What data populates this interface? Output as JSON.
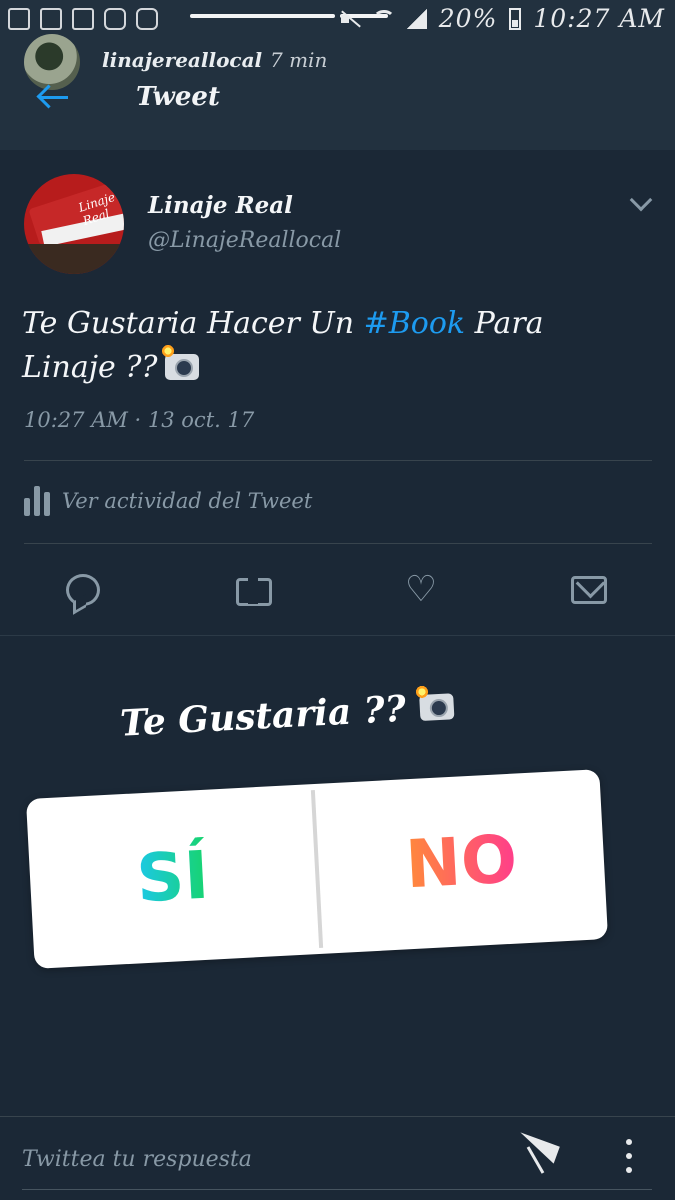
{
  "status_bar": {
    "battery_text": "20%",
    "clock": "10:27 AM"
  },
  "story_header": {
    "username": "linajereallocal",
    "time_ago": "7 min",
    "title": "Tweet"
  },
  "tweet": {
    "author_name": "Linaje Real",
    "author_handle": "@LinajeReallocal",
    "text_before": "Te Gustaria Hacer Un ",
    "hashtag": "#Book",
    "text_after": " Para Linaje ??",
    "timestamp": "10:27 AM · 13 oct. 17",
    "activity_label": "Ver actividad del Tweet",
    "avatar_logo_text": "Linaje Real"
  },
  "media": {
    "caption": "Te Gustaria ??",
    "poll_yes": "SÍ",
    "poll_no": "NO"
  },
  "reply": {
    "placeholder": "Twittea tu respuesta"
  },
  "colors": {
    "background": "#1b2836",
    "accent": "#1d9bf0",
    "muted": "#8899a6"
  }
}
